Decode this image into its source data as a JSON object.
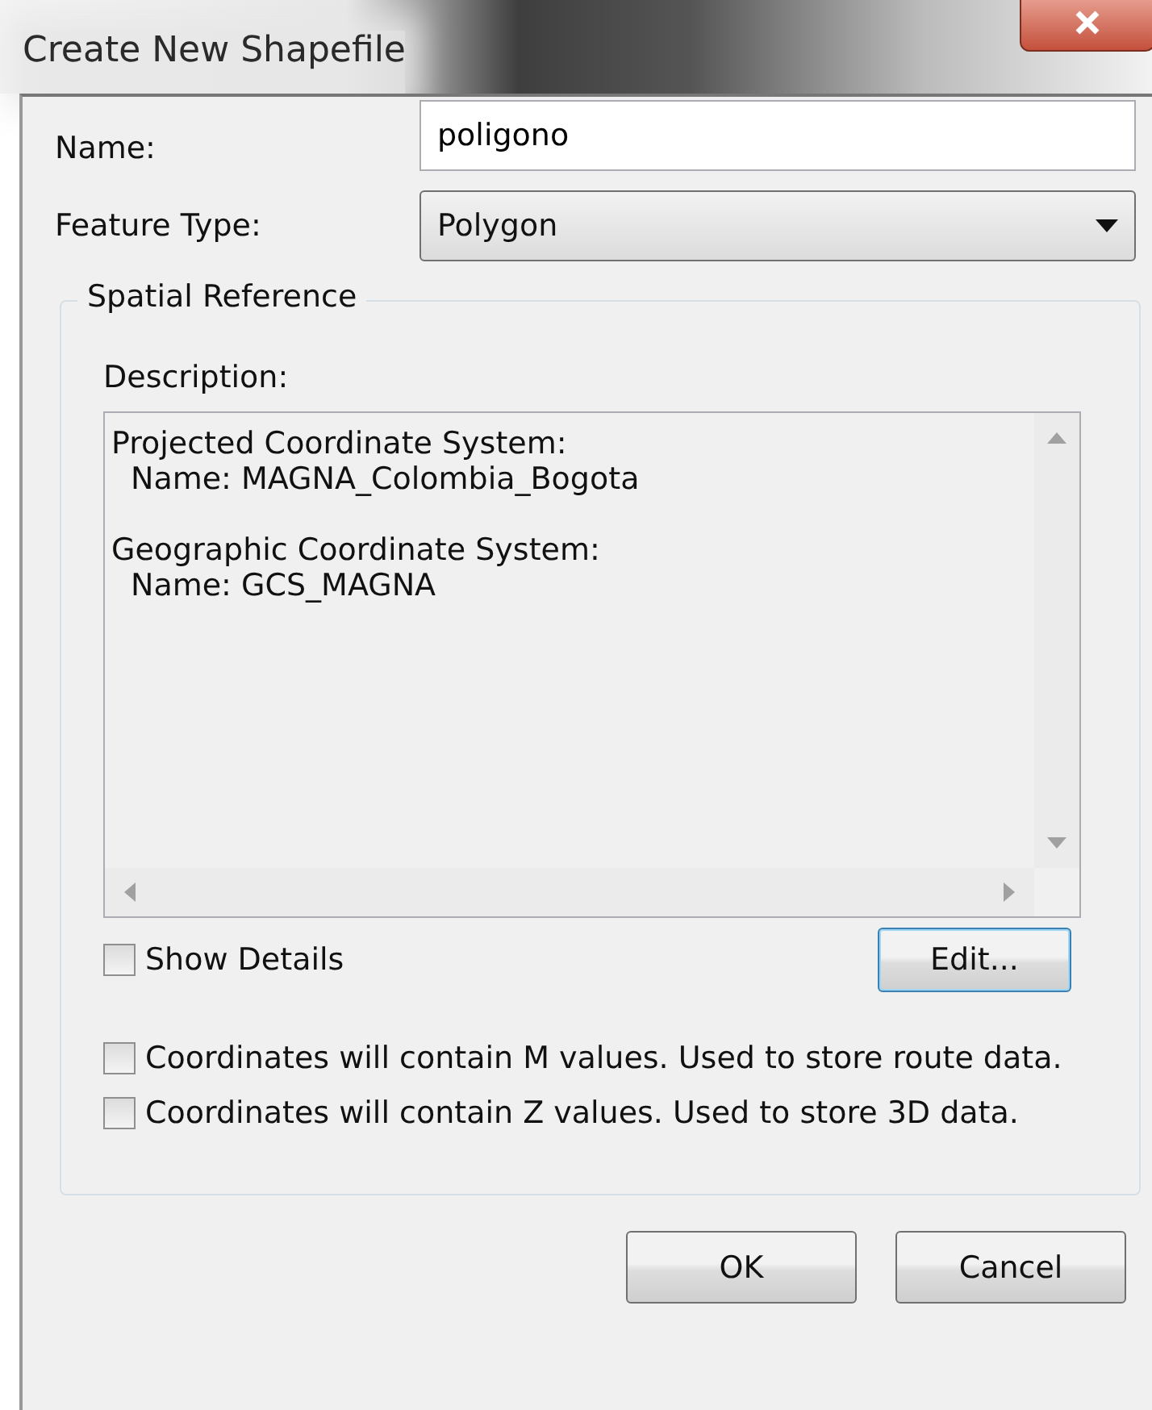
{
  "window": {
    "title": "Create New Shapefile"
  },
  "fields": [
    {
      "kind": "text",
      "label": "Name:",
      "value": "poligono"
    },
    {
      "kind": "dropdown",
      "label": "Feature Type:",
      "value": "Polygon"
    }
  ],
  "spatial_reference": {
    "title": "Spatial Reference",
    "description_label": "Description:",
    "description": [
      {
        "heading": "Projected Coordinate System:",
        "detail": "Name: MAGNA_Colombia_Bogota"
      },
      {
        "heading": "Geographic Coordinate System:",
        "detail": "Name: GCS_MAGNA"
      }
    ],
    "show_details": {
      "label": "Show Details",
      "checked": false
    },
    "edit_button": "Edit..."
  },
  "options": [
    {
      "label": "Coordinates will contain M values. Used to store route data.",
      "checked": false
    },
    {
      "label": "Coordinates will contain Z values. Used to store 3D data.",
      "checked": false
    }
  ],
  "buttons": [
    "OK",
    "Cancel"
  ]
}
